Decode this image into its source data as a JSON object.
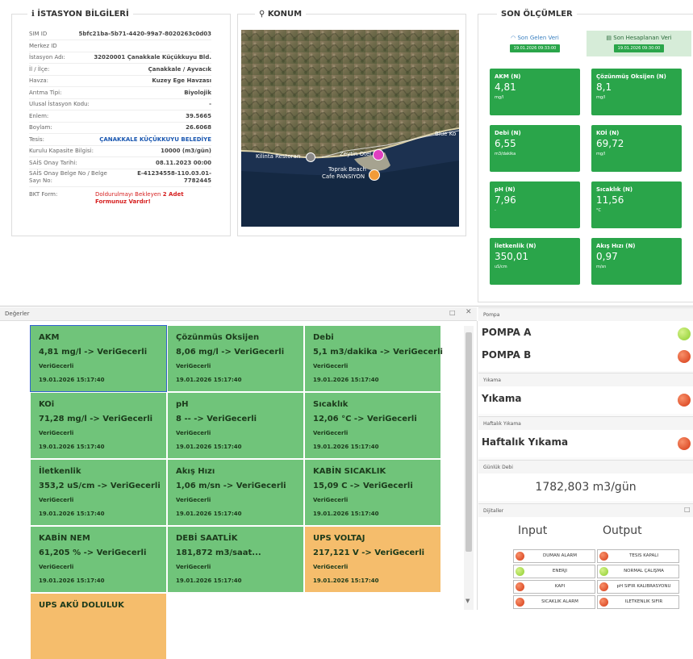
{
  "station": {
    "title": "İSTASYON BİLGİLERİ",
    "rows": [
      {
        "k": "SIM ID",
        "v": "5bfc21ba-5b71-4420-99a7-8020263c0d03"
      },
      {
        "k": "Merkez ID",
        "v": ""
      },
      {
        "k": "İstasyon Adı:",
        "v": "32020001 Çanakkale Küçükkuyu Bld."
      },
      {
        "k": "İl / İlçe:",
        "v": "Çanakkale / Ayvacık"
      },
      {
        "k": "Havza:",
        "v": "Kuzey Ege Havzası"
      },
      {
        "k": "Arıtma Tipi:",
        "v": "Biyolojik"
      },
      {
        "k": "Ulusal İstasyon Kodu:",
        "v": "-"
      },
      {
        "k": "Enlem:",
        "v": "39.5665"
      },
      {
        "k": "Boylam:",
        "v": "26.6068"
      },
      {
        "k": "Tesis:",
        "v": "ÇANAKKALE KÜÇÜKKUYU BELEDİYE"
      },
      {
        "k": "Kurulu Kapasite Bilgisi:",
        "v": "10000 (m3/gün)"
      },
      {
        "k": "SAİS Onay Tarihi:",
        "v": "08.11.2023 00:00"
      }
    ],
    "belge_label": "SAİS Onay Belge No / Belge Sayı No:",
    "belge_value": "E-41234558-110.03.01-7782445",
    "bkt_label": "BKT Form:",
    "bkt_value_1": "Doldurulmayı Bekleyen",
    "bkt_value_2": "2 Adet Formunuz Vardır!"
  },
  "map": {
    "title": "KONUM",
    "labels": {
      "blue": "Blue Ko",
      "kilinta": "Kilinta Restoran",
      "zeytin": "Zeytin Otel",
      "toprak": "Toprak Beach",
      "cafe": "Cafe PANSIYON"
    }
  },
  "measurements": {
    "title": "SON ÖLÇÜMLER",
    "tab_received": "Son Gelen Veri",
    "tab_received_date": "19.01.2026 09:33:00",
    "tab_calc": "Son Hesaplanan Veri",
    "tab_calc_date": "19.01.2026 09:30:00",
    "cards": [
      {
        "t": "AKM (N)",
        "n": "4,81",
        "u": "mg/l"
      },
      {
        "t": "Çözünmüş Oksijen (N)",
        "n": "8,1",
        "u": "mg/l"
      },
      {
        "t": "Debi (N)",
        "n": "6,55",
        "u": "m3/dakika"
      },
      {
        "t": "KOİ (N)",
        "n": "69,72",
        "u": "mg/l"
      },
      {
        "t": "pH (N)",
        "n": "7,96",
        "u": "-"
      },
      {
        "t": "Sıcaklık (N)",
        "n": "11,56",
        "u": "°C"
      },
      {
        "t": "İletkenlik (N)",
        "n": "350,01",
        "u": "uS/cm"
      },
      {
        "t": "Akış Hızı (N)",
        "n": "0,97",
        "u": "m/sn"
      }
    ]
  },
  "degerler": {
    "title": "Değerler",
    "cells": [
      {
        "t": "AKM",
        "v": "4,81 mg/l -> VeriGecerli",
        "s": "VeriGecerli",
        "d": "19.01.2026 15:17:40",
        "c": "green"
      },
      {
        "t": "Çözünmüs Oksijen",
        "v": "8,06 mg/l -> VeriGecerli",
        "s": "VeriGecerli",
        "d": "19.01.2026 15:17:40",
        "c": "green"
      },
      {
        "t": "Debi",
        "v": "5,1 m3/dakika -> VeriGecerli",
        "s": "VeriGecerli",
        "d": "19.01.2026 15:17:40",
        "c": "green"
      },
      {
        "t": "KOi",
        "v": "71,28 mg/l -> VeriGecerli",
        "s": "VeriGecerli",
        "d": "19.01.2026 15:17:40",
        "c": "green"
      },
      {
        "t": "pH",
        "v": "8 -- -> VeriGecerli",
        "s": "VeriGecerli",
        "d": "19.01.2026 15:17:40",
        "c": "green"
      },
      {
        "t": "Sıcaklık",
        "v": "12,06 °C -> VeriGecerli",
        "s": "VeriGecerli",
        "d": "19.01.2026 15:17:40",
        "c": "green"
      },
      {
        "t": "İletkenlik",
        "v": "353,2 uS/cm -> VeriGecerli",
        "s": "VeriGecerli",
        "d": "19.01.2026 15:17:40",
        "c": "green"
      },
      {
        "t": "Akış Hızı",
        "v": "1,06 m/sn -> VeriGecerli",
        "s": "VeriGecerli",
        "d": "19.01.2026 15:17:40",
        "c": "green"
      },
      {
        "t": "KABİN SICAKLIK",
        "v": "15,09 C -> VeriGecerli",
        "s": "VeriGecerli",
        "d": "19.01.2026 15:17:40",
        "c": "green"
      },
      {
        "t": "KABİN NEM",
        "v": "61,205 % -> VeriGecerli",
        "s": "VeriGecerli",
        "d": "19.01.2026 15:17:40",
        "c": "green"
      },
      {
        "t": "DEBİ SAATLİK",
        "v": "181,872 m3/saat...",
        "s": "VeriGecerli",
        "d": "19.01.2026 15:17:40",
        "c": "green"
      },
      {
        "t": "UPS VOLTAJ",
        "v": "217,121 V -> VeriGecerli",
        "s": "VeriGecerli",
        "d": "19.01.2026 15:17:40",
        "c": "orange"
      },
      {
        "t": "UPS AKÜ DOLULUK",
        "v": "",
        "s": "",
        "d": "",
        "c": "orange"
      }
    ]
  },
  "pompa": {
    "title": "Pompa",
    "a": "POMPA A",
    "b": "POMPA B",
    "yikama_head": "Yıkama",
    "yikama": "Yıkama",
    "haftalik_head": "Haftalık Yıkama",
    "haftalik": "Haftalık Yıkama",
    "gunluk_head": "Günlük Debi",
    "gunluk_value": "1782,803 m3/gün"
  },
  "dijital": {
    "title": "Dijitaller",
    "input_label": "Input",
    "output_label": "Output",
    "inputs": [
      {
        "l": "DUMAN ALARM",
        "c": "red"
      },
      {
        "l": "ENERJİ",
        "c": "green"
      },
      {
        "l": "KAPI",
        "c": "red"
      },
      {
        "l": "SICAKLIK ALARM",
        "c": "red"
      }
    ],
    "outputs": [
      {
        "l": "TESİS KAPALI",
        "c": "red"
      },
      {
        "l": "NORMAL ÇALIŞMA",
        "c": "green"
      },
      {
        "l": "pH SIFIR KALİBRASYONU",
        "c": "red"
      },
      {
        "l": "İLETKENLİK SIFIR",
        "c": "red"
      }
    ]
  },
  "colors": {
    "accent_green": "#2aa54a",
    "cell_green": "#70c47a",
    "cell_orange": "#f5bd6c",
    "led_red": "#d53a15",
    "led_green": "#8ccd2e",
    "link_blue": "#1a57b0",
    "alert_red": "#d62020"
  }
}
